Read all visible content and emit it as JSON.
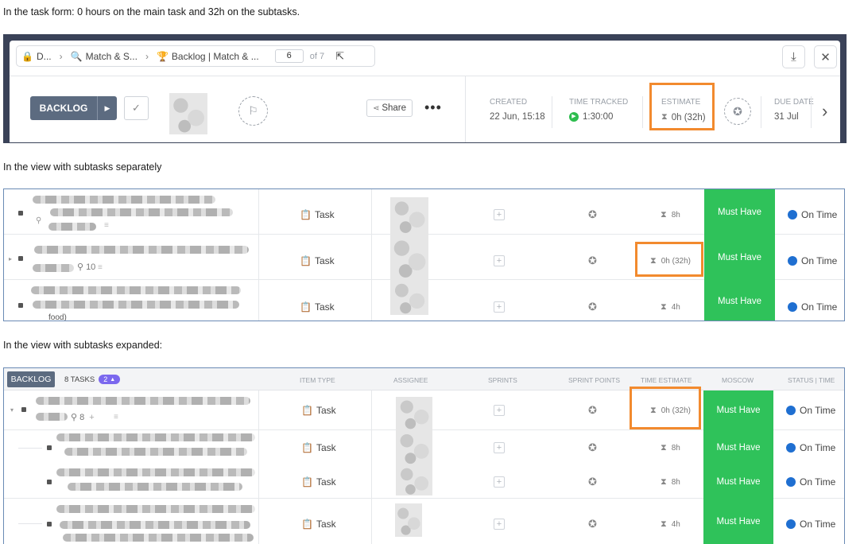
{
  "captions": {
    "form": "In the task form: 0 hours on the main task and 32h on the subtasks.",
    "separate": "In the view with subtasks separately",
    "expanded": "In the view with subtasks expanded:"
  },
  "form": {
    "breadcrumbs": [
      {
        "icon": "lock-icon",
        "label": "D..."
      },
      {
        "icon": "search-icon",
        "label": "Match & S..."
      },
      {
        "icon": "trophy-icon",
        "label": "Backlog | Match & ..."
      }
    ],
    "pager": {
      "current": "6",
      "total_label": "of 7"
    },
    "status_label": "BACKLOG",
    "share_label": "Share",
    "created": {
      "label": "CREATED",
      "value": "22 Jun, 15:18"
    },
    "time_tracked": {
      "label": "TIME TRACKED",
      "value": "1:30:00"
    },
    "estimate": {
      "label": "ESTIMATE",
      "value": "0h (32h)"
    },
    "due_date": {
      "label": "DUE DATE",
      "value": "31 Jul"
    }
  },
  "separate_view": {
    "rows": [
      {
        "type": "Task",
        "estimate": "8h",
        "moscow": "Must Have",
        "status": "On Time",
        "meta": ""
      },
      {
        "type": "Task",
        "estimate": "0h (32h)",
        "moscow": "Must Have",
        "status": "On Time",
        "meta": "10"
      },
      {
        "type": "Task",
        "estimate": "4h",
        "moscow": "Must Have",
        "status": "On Time",
        "meta": "food)"
      }
    ]
  },
  "expanded_view": {
    "group_label": "BACKLOG",
    "task_count": "8 TASKS",
    "subtask_badge": "2",
    "columns": {
      "item_type": "ITEM TYPE",
      "assignee": "ASSIGNEE",
      "sprints": "SPRINTS",
      "sprint_points": "SPRINT POINTS",
      "time_estimate": "TIME ESTIMATE",
      "moscow": "MOSCOW",
      "status_time": "STATUS | TIME"
    },
    "rows": [
      {
        "type": "Task",
        "estimate": "0h (32h)",
        "moscow": "Must Have",
        "status": "On Time",
        "meta": "8"
      },
      {
        "type": "Task",
        "estimate": "8h",
        "moscow": "Must Have",
        "status": "On Time"
      },
      {
        "type": "Task",
        "estimate": "8h",
        "moscow": "Must Have",
        "status": "On Time"
      },
      {
        "type": "Task",
        "estimate": "4h",
        "moscow": "Must Have",
        "status": "On Time"
      }
    ]
  },
  "colors": {
    "highlight": "#f28a2e",
    "must_have": "#2fc25a",
    "status_dot": "#1f6fd1",
    "backlog": "#5c6b80"
  }
}
